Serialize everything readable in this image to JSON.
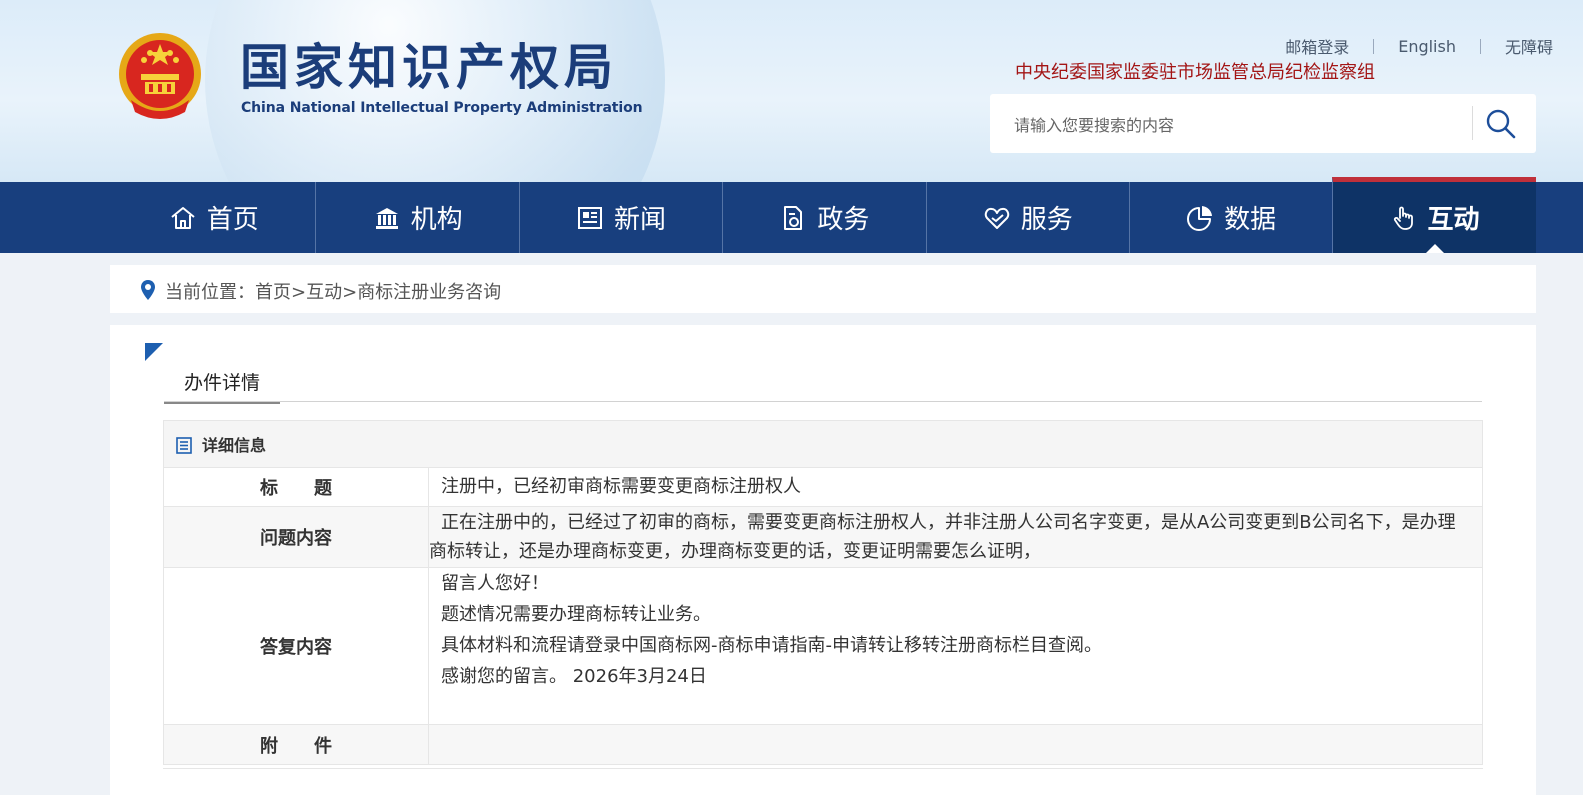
{
  "header": {
    "site_title": "国家知识产权局",
    "site_subtitle": "China National Intellectual Property Administration",
    "emblem_icon": "national-emblem-icon",
    "top_links": [
      "邮箱登录",
      "English",
      "无障碍"
    ],
    "discipline_text": "中央纪委国家监委驻市场监管总局纪检监察组",
    "search": {
      "placeholder": "请输入您要搜索的内容",
      "icon": "search-icon"
    }
  },
  "nav": {
    "items": [
      {
        "label": "首页",
        "icon": "home-icon"
      },
      {
        "label": "机构",
        "icon": "institution-icon"
      },
      {
        "label": "新闻",
        "icon": "news-icon"
      },
      {
        "label": "政务",
        "icon": "government-affairs-icon"
      },
      {
        "label": "服务",
        "icon": "service-icon"
      },
      {
        "label": "数据",
        "icon": "pie-chart-icon"
      },
      {
        "label": "互动",
        "icon": "hand-pointer-icon"
      }
    ],
    "active": "互动"
  },
  "breadcrumb": {
    "prefix": "当前位置：",
    "items": [
      "首页",
      "互动",
      "商标注册业务咨询"
    ],
    "separator": ">"
  },
  "section": {
    "tab_label": "办件详情"
  },
  "detail": {
    "header": "详细信息",
    "rows": {
      "title_label": "标　　题",
      "title_value": "注册中，已经初审商标需要变更商标注册权人",
      "question_label": "问题内容",
      "question_value": "正在注册中的，已经过了初审的商标，需要变更商标注册权人，并非注册人公司名字变更，是从A公司变更到B公司名下，是办理商标转让，还是办理商标变更，办理商标变更的话，变更证明需要怎么证明，",
      "answer_label": "答复内容",
      "answer_lines": [
        "留言人您好！",
        "题述情况需要办理商标转让业务。",
        "具体材料和流程请登录中国商标网-商标申请指南-申请转让移转注册商标栏目查阅。",
        "感谢您的留言。 2026年3月24日"
      ],
      "attachment_label": "附　　件",
      "attachment_value": ""
    }
  },
  "colors": {
    "nav_bg": "#183f7e",
    "nav_active_bg": "#0e3366",
    "nav_active_top": "#c0303a",
    "title_blue": "#1b3d7a",
    "discipline_red": "#a31515"
  }
}
